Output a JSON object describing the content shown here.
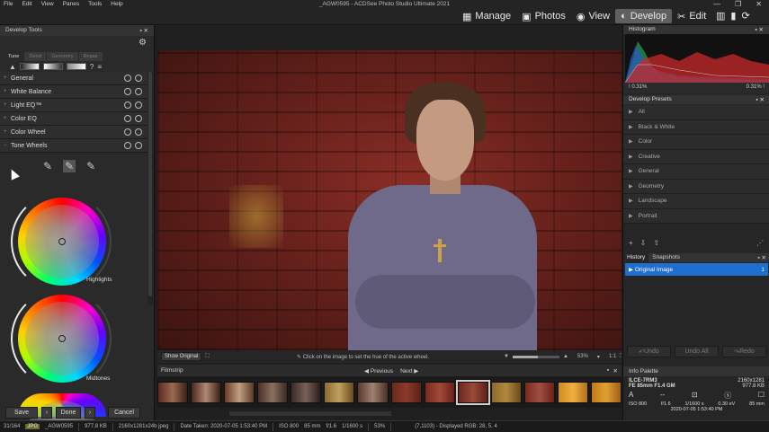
{
  "menu": [
    "File",
    "Edit",
    "View",
    "Panes",
    "Tools",
    "Help"
  ],
  "app_title": "_AGW0595 - ACDSee Photo Studio Ultimate 2021",
  "modes": [
    {
      "label": "Manage",
      "icon": "grid-icon"
    },
    {
      "label": "Photos",
      "icon": "image-icon"
    },
    {
      "label": "View",
      "icon": "eye-icon"
    },
    {
      "label": "Develop",
      "icon": "develop-icon",
      "active": true
    },
    {
      "label": "Edit",
      "icon": "edit-icon"
    }
  ],
  "left_panel": {
    "title": "Develop Tools",
    "tabs": [
      "Tune",
      "Detail",
      "Geometry",
      "Repair"
    ],
    "groups": [
      "General",
      "White Balance",
      "Light EQ™",
      "Color EQ",
      "Color Wheel",
      "Tone Wheels"
    ],
    "wheels": [
      "Highlights",
      "Midtones"
    ],
    "buttons": {
      "save": "Save",
      "done": "Done",
      "cancel": "Cancel"
    }
  },
  "center": {
    "show_original": "Show Original",
    "hint": "Click on the image to set the hue of the active wheel.",
    "zoom": "53%",
    "zoom_level": 0.53,
    "ratio": "1:1",
    "filmstrip_title": "Filmstrip",
    "previous": "Previous",
    "next": "Next"
  },
  "right_panel": {
    "histogram_title": "Histogram",
    "hist_left": "0.31%",
    "hist_right": "0.31%",
    "presets_title": "Develop Presets",
    "presets": [
      "All",
      "Black & White",
      "Color",
      "Creative",
      "General",
      "Geometry",
      "Landscape",
      "Portrait"
    ],
    "history_tab": "History",
    "snapshots_tab": "Snapshots",
    "history_item": "Original Image",
    "history_num": "1",
    "undo": "Undo",
    "undo_all": "Undo All",
    "redo": "Redo",
    "info_title": "Info Palette",
    "camera": "ILCE-7RM3",
    "lens": "FE 85mm F1.4 GM",
    "resolution": "2160x1281",
    "filesize": "977.8 KB",
    "iso": "ISO 800",
    "aperture": "f/1.6",
    "shutter": "1/1600 s",
    "exposure": "0.30 eV",
    "focal": "85 mm",
    "date": "2020-07-05 1:53:40 PM"
  },
  "statusbar": {
    "count": "31/164",
    "type": "JPG",
    "file": "_AGW0595",
    "size": "977.8 KB",
    "dims": "2160x1281x24b jpeg",
    "date": "Date Taken: 2020-07-05 1:53:40 PM",
    "iso": "ISO 800",
    "focal": "85 mm",
    "ap": "f/1.6",
    "shutter": "1/1600 s",
    "zoom": "53%",
    "pixel": "(7,1103) - Displayed RGB: 28, 5, 4"
  }
}
